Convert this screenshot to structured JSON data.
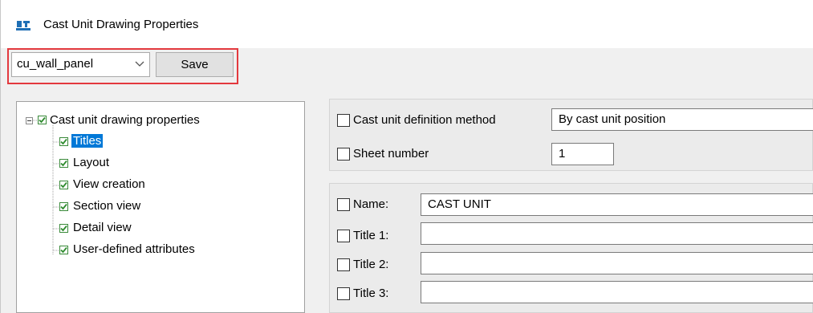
{
  "window": {
    "title": "Cast Unit Drawing Properties",
    "icon": "tekla-drawing-icon"
  },
  "toolbar": {
    "preset_value": "cu_wall_panel",
    "save_label": "Save"
  },
  "tree": {
    "root": {
      "label": "Cast unit drawing properties",
      "checked": true,
      "expanded": true
    },
    "items": [
      {
        "label": "Titles",
        "checked": true,
        "selected": true
      },
      {
        "label": "Layout",
        "checked": true
      },
      {
        "label": "View creation",
        "checked": true
      },
      {
        "label": "Section view",
        "checked": true
      },
      {
        "label": "Detail view",
        "checked": true
      },
      {
        "label": "User-defined attributes",
        "checked": true
      }
    ]
  },
  "settings": {
    "definition_method": {
      "label": "Cast unit definition method",
      "value": "By cast unit position"
    },
    "sheet_number": {
      "label": "Sheet number",
      "value": "1"
    }
  },
  "titles": {
    "name": {
      "label": "Name:",
      "value": "CAST UNIT"
    },
    "title1": {
      "label": "Title 1:",
      "value": ""
    },
    "title2": {
      "label": "Title 2:",
      "value": ""
    },
    "title3": {
      "label": "Title 3:",
      "value": ""
    }
  },
  "colors": {
    "highlight": "#e3393e",
    "selection": "#0078d7",
    "check": "#2e8b2e"
  }
}
